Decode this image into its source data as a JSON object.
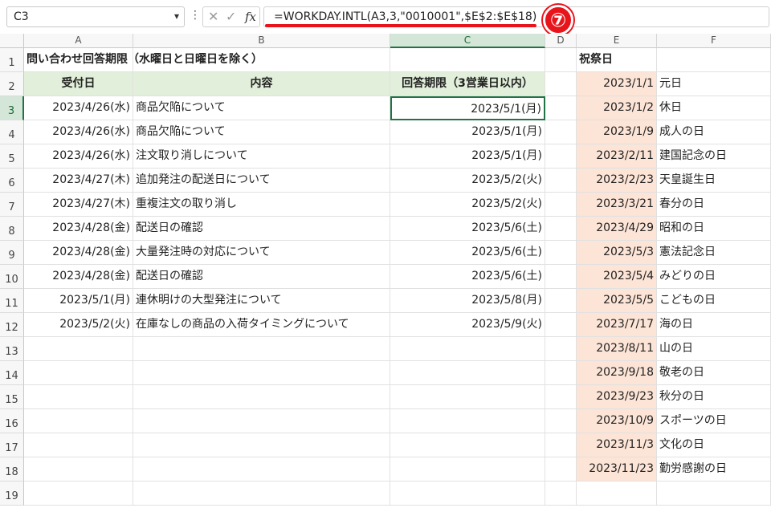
{
  "formula_bar": {
    "name_box": "C3",
    "formula": "=WORKDAY.INTL(A3,3,\"0010001\",$E$2:$E$18)",
    "cancel_icon": "✕",
    "enter_icon": "✓",
    "fx_label": "fx",
    "callout_number": "⑦"
  },
  "columns": [
    "A",
    "B",
    "C",
    "D",
    "E",
    "F"
  ],
  "row_numbers": [
    "1",
    "2",
    "3",
    "4",
    "5",
    "6",
    "7",
    "8",
    "9",
    "10",
    "11",
    "12",
    "13",
    "14",
    "15",
    "16",
    "17",
    "18",
    "19"
  ],
  "sheet": {
    "title": "問い合わせ回答期限（水曜日と日曜日を除く）",
    "header_receipt": "受付日",
    "header_content": "内容",
    "header_deadline": "回答期限（3営業日以内）",
    "holiday_header": "祝祭日",
    "rows": [
      {
        "date": "2023/4/26(水)",
        "content": "商品欠陥について",
        "deadline": "2023/5/1(月)"
      },
      {
        "date": "2023/4/26(水)",
        "content": "商品欠陥について",
        "deadline": "2023/5/1(月)"
      },
      {
        "date": "2023/4/26(水)",
        "content": "注文取り消しについて",
        "deadline": "2023/5/1(月)"
      },
      {
        "date": "2023/4/27(木)",
        "content": "追加発注の配送日について",
        "deadline": "2023/5/2(火)"
      },
      {
        "date": "2023/4/27(木)",
        "content": "重複注文の取り消し",
        "deadline": "2023/5/2(火)"
      },
      {
        "date": "2023/4/28(金)",
        "content": "配送日の確認",
        "deadline": "2023/5/6(土)"
      },
      {
        "date": "2023/4/28(金)",
        "content": "大量発注時の対応について",
        "deadline": "2023/5/6(土)"
      },
      {
        "date": "2023/4/28(金)",
        "content": "配送日の確認",
        "deadline": "2023/5/6(土)"
      },
      {
        "date": "2023/5/1(月)",
        "content": "連休明けの大型発注について",
        "deadline": "2023/5/8(月)"
      },
      {
        "date": "2023/5/2(火)",
        "content": "在庫なしの商品の入荷タイミングについて",
        "deadline": "2023/5/9(火)"
      }
    ],
    "holidays": [
      {
        "date": "2023/1/1",
        "name": "元日"
      },
      {
        "date": "2023/1/2",
        "name": "休日"
      },
      {
        "date": "2023/1/9",
        "name": "成人の日"
      },
      {
        "date": "2023/2/11",
        "name": "建国記念の日"
      },
      {
        "date": "2023/2/23",
        "name": "天皇誕生日"
      },
      {
        "date": "2023/3/21",
        "name": "春分の日"
      },
      {
        "date": "2023/4/29",
        "name": "昭和の日"
      },
      {
        "date": "2023/5/3",
        "name": "憲法記念日"
      },
      {
        "date": "2023/5/4",
        "name": "みどりの日"
      },
      {
        "date": "2023/5/5",
        "name": "こどもの日"
      },
      {
        "date": "2023/7/17",
        "name": "海の日"
      },
      {
        "date": "2023/8/11",
        "name": "山の日"
      },
      {
        "date": "2023/9/18",
        "name": "敬老の日"
      },
      {
        "date": "2023/9/23",
        "name": "秋分の日"
      },
      {
        "date": "2023/10/9",
        "name": "スポーツの日"
      },
      {
        "date": "2023/11/3",
        "name": "文化の日"
      },
      {
        "date": "2023/11/23",
        "name": "勤労感謝の日"
      }
    ]
  },
  "colors": {
    "header_fill": "#e2efda",
    "holiday_fill": "#fce4d6",
    "selection": "#217346",
    "callout": "#e8141c"
  }
}
